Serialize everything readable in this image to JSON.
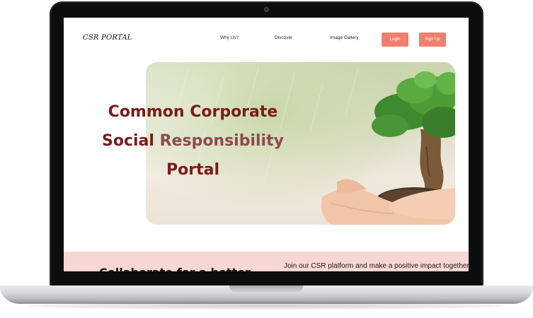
{
  "nav": {
    "brand": "CSR PORTAL",
    "links": [
      "Why Us?",
      "Discover",
      "Image Gallery"
    ],
    "login_label": "Login",
    "signup_label": "Sign Up"
  },
  "hero": {
    "line1": "Common Corporate",
    "line2a": "Social ",
    "line2b": "Responsibility",
    "line3": "Portal",
    "image": "hands-holding-tree-image"
  },
  "band": {
    "tagline": "Join our CSR platform and make a positive impact together.",
    "heading": "Collaborate for a better"
  },
  "colors": {
    "accent": "#ef7f6f",
    "title": "#7a1c1c",
    "band": "#f7d7d2"
  }
}
